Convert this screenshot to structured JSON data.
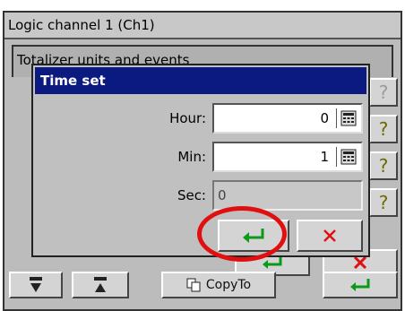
{
  "window": {
    "title": "Logic channel 1 (Ch1)",
    "subtitle": "Totalizer units and events"
  },
  "side_buttons": [
    {
      "icon": "key-icon",
      "glyph": "?",
      "disabled": true
    },
    {
      "icon": "key-icon",
      "glyph": "?",
      "disabled": false
    },
    {
      "icon": "key-icon",
      "glyph": "?",
      "disabled": false
    },
    {
      "icon": "key-icon",
      "glyph": "?",
      "disabled": false
    }
  ],
  "toolbar": {
    "copy_label": "CopyTo"
  },
  "dialog": {
    "title": "Time set",
    "fields": [
      {
        "label": "Hour:",
        "value": "0",
        "editable": true
      },
      {
        "label": "Min:",
        "value": "1",
        "editable": true
      },
      {
        "label": "Sec:",
        "value": "0",
        "editable": false
      }
    ],
    "ok_icon": "enter-icon",
    "cancel_icon": "close-icon"
  },
  "colors": {
    "dialog_title_bg": "#0a1a80",
    "ok_green": "#0a9a1a",
    "cancel_red": "#e01010",
    "highlight_circle": "#e01010"
  }
}
